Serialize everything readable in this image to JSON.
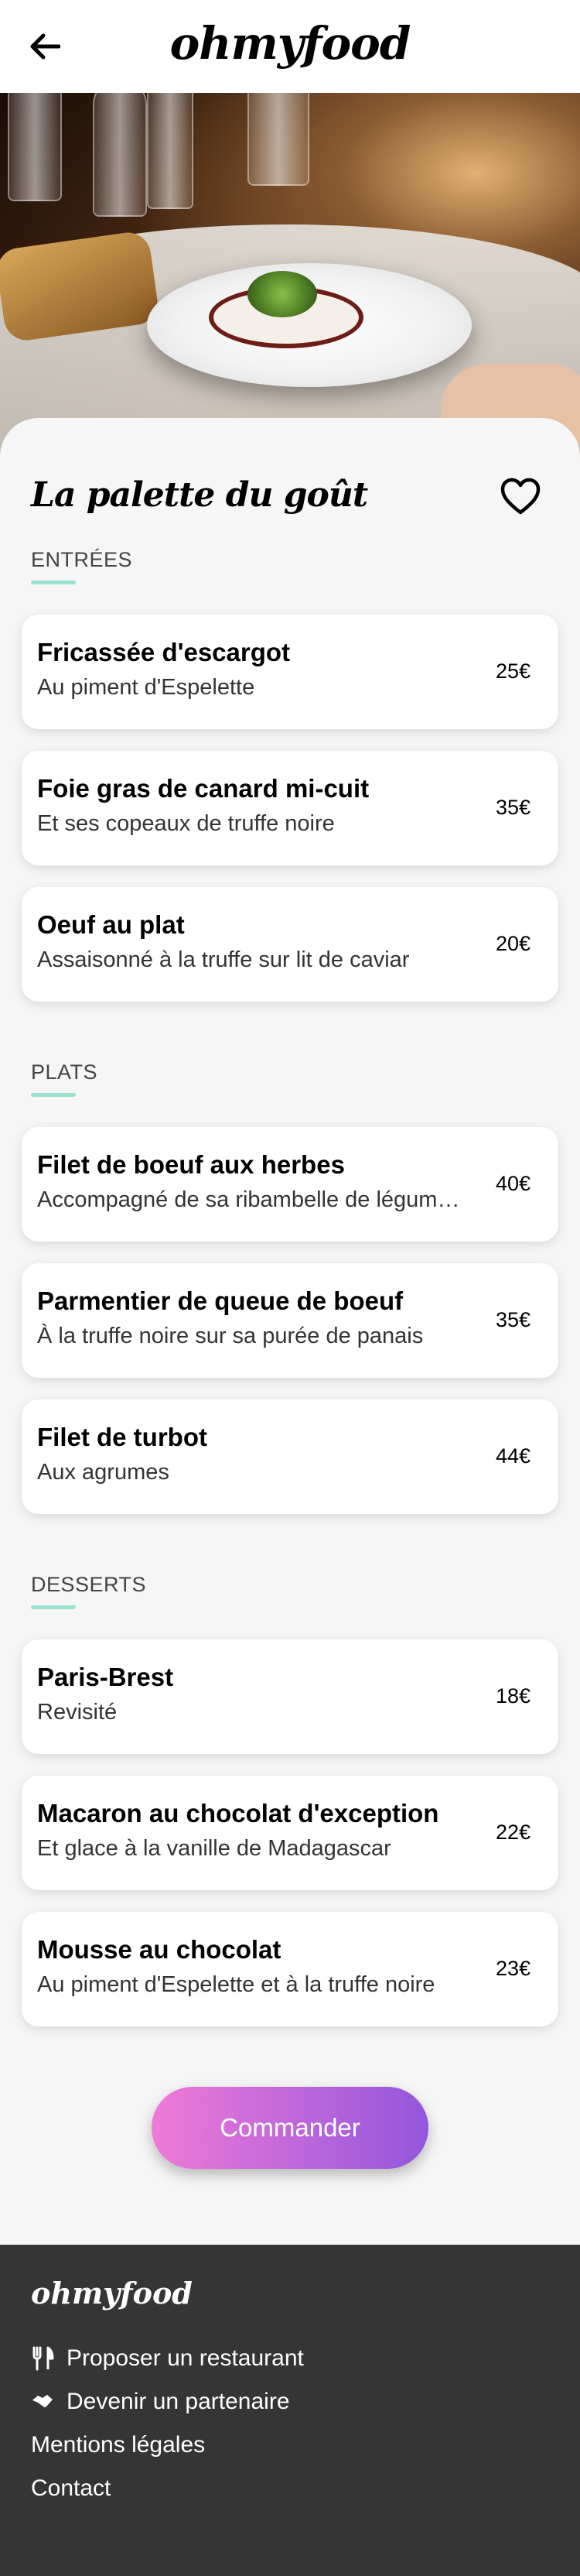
{
  "header": {
    "logo": "ohmyfood"
  },
  "restaurant": {
    "name": "La palette du goût"
  },
  "sections": [
    {
      "title": "ENTRÉES",
      "dishes": [
        {
          "name": "Fricassée d'escargot",
          "desc": "Au piment d'Espelette",
          "price": "25€"
        },
        {
          "name": "Foie gras de canard mi-cuit",
          "desc": "Et ses copeaux de truffe noire",
          "price": "35€"
        },
        {
          "name": "Oeuf au plat",
          "desc": "Assaisonné à la truffe sur lit de caviar",
          "price": "20€"
        }
      ]
    },
    {
      "title": "PLATS",
      "dishes": [
        {
          "name": "Filet de boeuf aux herbes",
          "desc": "Accompagné de sa ribambelle de légum…",
          "price": "40€"
        },
        {
          "name": "Parmentier de queue de boeuf",
          "desc": "À la truffe noire sur sa purée de panais",
          "price": "35€"
        },
        {
          "name": "Filet de turbot",
          "desc": "Aux agrumes",
          "price": "44€"
        }
      ]
    },
    {
      "title": "DESSERTS",
      "dishes": [
        {
          "name": "Paris-Brest",
          "desc": "Revisité",
          "price": "18€"
        },
        {
          "name": "Macaron au chocolat d'exception",
          "desc": "Et glace à la vanille de Madagascar",
          "price": "22€"
        },
        {
          "name": "Mousse au chocolat",
          "desc": "Au piment d'Espelette et à la truffe noire",
          "price": "23€"
        }
      ]
    }
  ],
  "order_button": "Commander",
  "footer": {
    "logo": "ohmyfood",
    "links": [
      {
        "label": "Proposer un restaurant",
        "icon": "utensils-icon"
      },
      {
        "label": "Devenir un partenaire",
        "icon": "handshake-icon"
      },
      {
        "label": "Mentions légales"
      },
      {
        "label": "Contact"
      }
    ]
  },
  "colors": {
    "accent_underline": "#99e2d0",
    "button_start": "#ef7ad8",
    "button_end": "#9356dc",
    "footer_bg": "#353535"
  }
}
